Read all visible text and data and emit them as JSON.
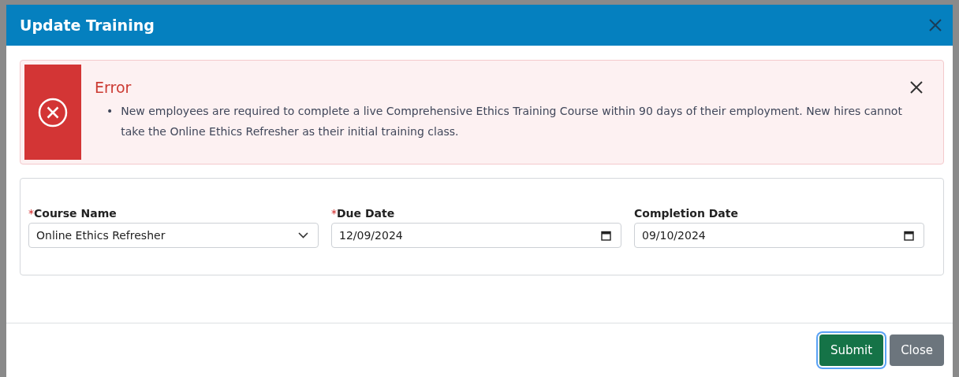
{
  "dialog": {
    "title": "Update Training"
  },
  "alert": {
    "title": "Error",
    "messages": [
      {
        "bullet": "•",
        "text": "New employees are required to complete a live Comprehensive Ethics Training Course within 90 days of their employment. New hires cannot take the Online Ethics Refresher as their initial training class."
      }
    ]
  },
  "form": {
    "fields": [
      {
        "kind": "select",
        "label": "Course Name",
        "required_mark": "*",
        "value": "Online Ethics Refresher"
      },
      {
        "kind": "date",
        "label": "Due Date",
        "required_mark": "*",
        "value": "12/09/2024"
      },
      {
        "kind": "date",
        "label": "Completion Date",
        "value": "09/10/2024"
      }
    ]
  },
  "buttons": [
    {
      "kind": "primary",
      "label": "Submit",
      "focused": true
    },
    {
      "kind": "secondary",
      "label": "Close",
      "focused": false
    }
  ]
}
